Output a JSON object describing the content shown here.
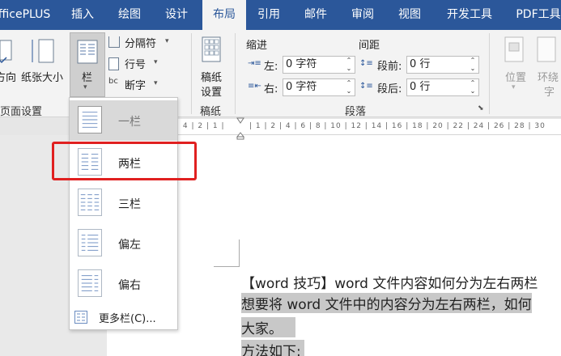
{
  "tabs": [
    "fficePLUS",
    "插入",
    "绘图",
    "设计",
    "布局",
    "引用",
    "邮件",
    "审阅",
    "视图",
    "开发工具",
    "PDF工具"
  ],
  "active_tab": "布局",
  "ribbon": {
    "page_setup": {
      "direction_label": "方向",
      "paper_size_label": "纸张大小",
      "columns_label": "栏",
      "separator_label": "分隔符",
      "line_numbers_label": "行号",
      "hyphenation_label": "断字",
      "group_label": "页面设置"
    },
    "draft": {
      "button_label_1": "稿纸",
      "button_label_2": "设置",
      "group_label": "稿纸"
    },
    "paragraph": {
      "indent_label": "缩进",
      "spacing_label": "间距",
      "left_label": "左:",
      "left_value": "0 字符",
      "right_label": "右:",
      "right_value": "0 字符",
      "before_label": "段前:",
      "before_value": "0 行",
      "after_label": "段后:",
      "after_value": "0 行",
      "group_label": "段落"
    },
    "arrange": {
      "position_label": "位置",
      "wrap_label": "环绕",
      "wrap_sub": "字"
    }
  },
  "columns_menu": {
    "items": [
      "一栏",
      "两栏",
      "三栏",
      "偏左",
      "偏右"
    ],
    "selected": "一栏",
    "more": "更多栏(C)..."
  },
  "ruler": {
    "left_nums": "| 4 | 2 | 1 |",
    "nums": "| 1 | 2 | 4 | 6 | 8 | 10 | 12 | 14 | 16 | 18 | 20 | 22 | 24 | 26 | 28 | 30"
  },
  "document": {
    "line1": "【word 技巧】word 文件内容如何分为左右两栏",
    "line2": "想要将 word 文件中的内容分为左右两栏，如何",
    "line3": "大家。",
    "line4": "方法如下:"
  },
  "colors": {
    "accent": "#2b579a",
    "highlight_box": "#e02020"
  }
}
